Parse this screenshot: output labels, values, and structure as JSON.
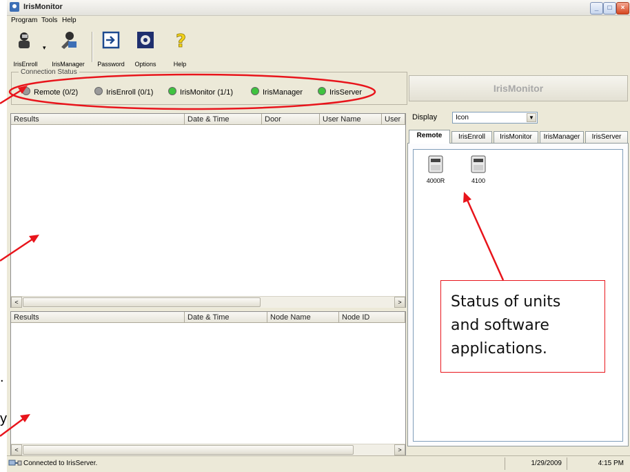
{
  "window": {
    "title": "IrisMonitor"
  },
  "menu": [
    "Program",
    "Tools",
    "Help"
  ],
  "toolbar": {
    "buttons": [
      {
        "label": "IrisEnroll",
        "icon": "person-camera-icon"
      },
      {
        "label": "IrisManager",
        "icon": "wrench-person-icon"
      },
      {
        "label": "Password",
        "icon": "arrow-enter-icon"
      },
      {
        "label": "Options",
        "icon": "gear-settings-icon"
      },
      {
        "label": "Help",
        "icon": "question-mark-icon"
      }
    ]
  },
  "connection_status": {
    "label": "Connection Status",
    "items": [
      {
        "label": "Remote (0/2)",
        "color": "#9a9a9a"
      },
      {
        "label": "IrisEnroll (0/1)",
        "color": "#9a9a9a"
      },
      {
        "label": "IrisMonitor (1/1)",
        "color": "#3fc33f"
      },
      {
        "label": "IrisManager",
        "color": "#3fc33f"
      },
      {
        "label": "IrisServer",
        "color": "#3fc33f"
      }
    ]
  },
  "results_table_1": {
    "columns": [
      "Results",
      "Date & Time",
      "Door",
      "User Name",
      "User"
    ]
  },
  "results_table_2": {
    "columns": [
      "Results",
      "Date & Time",
      "Node Name",
      "Node ID"
    ]
  },
  "right_panel": {
    "banner": "IrisMonitor",
    "display_label": "Display",
    "display_value": "Icon",
    "tabs": [
      "Remote",
      "IrisEnroll",
      "IrisMonitor",
      "IrisManager",
      "IrisServer"
    ],
    "active_tab": "Remote",
    "devices": [
      {
        "label": "4000R",
        "icon": "device-terminal-icon"
      },
      {
        "label": "4100",
        "icon": "device-terminal-icon"
      }
    ]
  },
  "status_bar": {
    "message": "Connected to IrisServer.",
    "date": "1/29/2009",
    "time": "4:15 PM"
  },
  "annotation": {
    "callout_text": [
      "Status of units",
      "and software",
      "applications."
    ],
    "accent_color": "#e8141b",
    "edge_fragments": [
      ".",
      "y"
    ]
  }
}
